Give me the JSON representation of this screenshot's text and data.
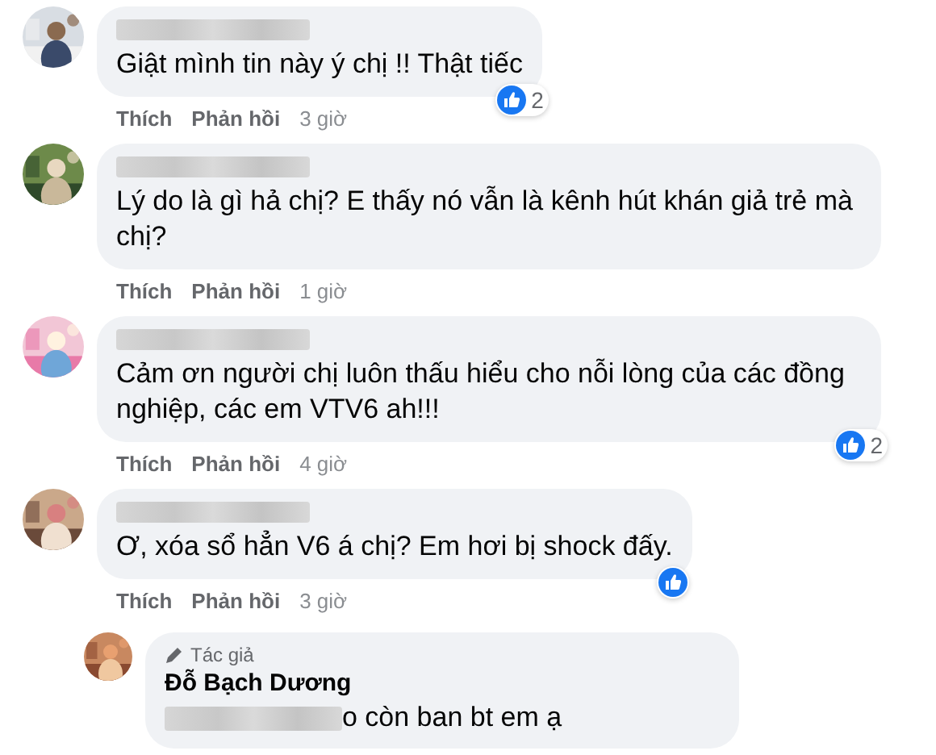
{
  "comments": [
    {
      "text": "Giật mình tin này ý chị !! Thật tiếc",
      "liked": true,
      "like_count": "2",
      "actions": [
        "Thích",
        "Phản hồi"
      ],
      "time": "3 giờ"
    },
    {
      "text": "Lý do là gì hả chị? E thấy nó vẫn là kênh hút khán giả trẻ mà chị?",
      "liked": false,
      "actions": [
        "Thích",
        "Phản hồi"
      ],
      "time": "1 giờ"
    },
    {
      "text": "Cảm ơn người chị luôn thấu hiểu cho nỗi lòng của các đồng nghiệp, các em VTV6 ah!!!",
      "liked": true,
      "like_count": "2",
      "actions": [
        "Thích",
        "Phản hồi"
      ],
      "time": "4 giờ"
    },
    {
      "text": "Ơ, xóa sổ hẳn V6 á chị? Em hơi bị shock đấy.",
      "liked": true,
      "actions": [
        "Thích",
        "Phản hồi"
      ],
      "time": "3 giờ"
    }
  ],
  "reply": {
    "badge": "Tác giả",
    "name": "Đỗ Bạch Dương",
    "text": "o còn ban bt em ạ"
  }
}
